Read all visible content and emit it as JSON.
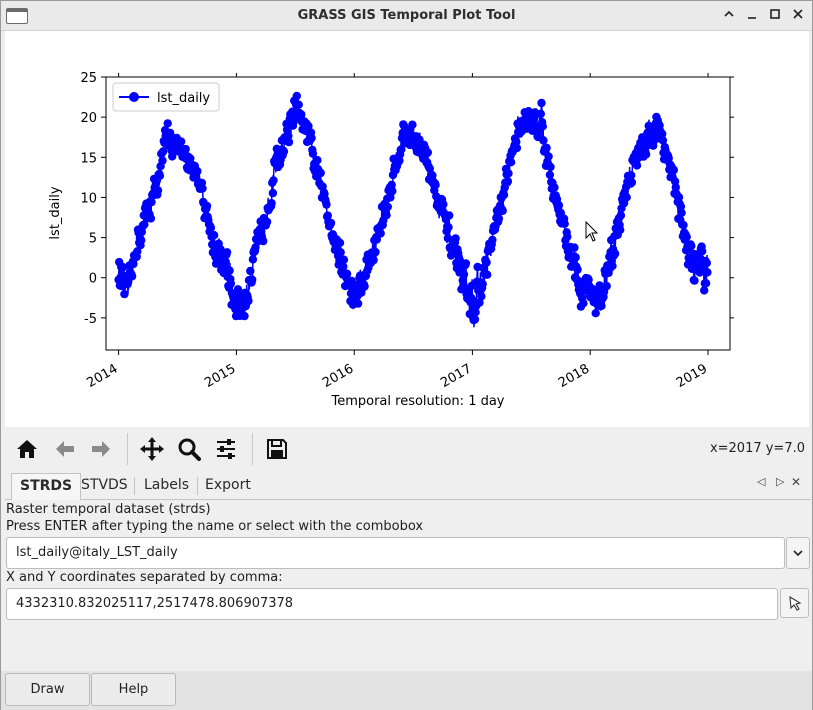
{
  "window": {
    "title": "GRASS GIS Temporal Plot Tool",
    "controls": [
      "minimize-chevron",
      "minimize",
      "maximize",
      "close"
    ]
  },
  "colors": {
    "series": "#0000ff",
    "plot_background": "#ffffff",
    "window_background": "#efefef"
  },
  "chart_data": {
    "type": "line",
    "title": "",
    "xlabel": "Temporal resolution: 1 day",
    "ylabel": "lst_daily",
    "x_ticks": [
      "2014",
      "2015",
      "2016",
      "2017",
      "2018",
      "2019"
    ],
    "y_ticks": [
      "-5",
      "0",
      "5",
      "10",
      "15",
      "20",
      "25"
    ],
    "xlim": [
      "2013-11-23",
      "2019-03-10"
    ],
    "ylim": [
      -9,
      25
    ],
    "grid": false,
    "legend": {
      "position": "top-left",
      "entries": [
        "lst_daily"
      ]
    },
    "marker": "circle",
    "series": [
      {
        "name": "lst_daily",
        "color": "#0000ff",
        "envelope": [
          {
            "date": "2014-01-01",
            "low": -2.0,
            "high": 3.5
          },
          {
            "date": "2014-02-01",
            "low": -5.0,
            "high": 2.0
          },
          {
            "date": "2014-03-01",
            "low": 2.0,
            "high": 8.0
          },
          {
            "date": "2014-04-01",
            "low": 5.0,
            "high": 12.0
          },
          {
            "date": "2014-05-01",
            "low": 9.0,
            "high": 15.0
          },
          {
            "date": "2014-06-01",
            "low": 15.0,
            "high": 21.0
          },
          {
            "date": "2014-07-01",
            "low": 13.0,
            "high": 19.0
          },
          {
            "date": "2014-08-01",
            "low": 12.0,
            "high": 17.0
          },
          {
            "date": "2014-09-01",
            "low": 11.0,
            "high": 15.0
          },
          {
            "date": "2014-10-01",
            "low": 5.0,
            "high": 11.0
          },
          {
            "date": "2014-11-01",
            "low": 0.0,
            "high": 6.0
          },
          {
            "date": "2014-12-01",
            "low": -4.0,
            "high": 5.0
          },
          {
            "date": "2015-01-01",
            "low": -7.0,
            "high": 0.0
          },
          {
            "date": "2015-02-01",
            "low": -6.0,
            "high": 2.0
          },
          {
            "date": "2015-03-01",
            "low": 0.0,
            "high": 6.0
          },
          {
            "date": "2015-04-01",
            "low": 5.0,
            "high": 11.0
          },
          {
            "date": "2015-05-01",
            "low": 10.0,
            "high": 17.0
          },
          {
            "date": "2015-06-01",
            "low": 15.0,
            "high": 20.0
          },
          {
            "date": "2015-07-01",
            "low": 18.0,
            "high": 24.0
          },
          {
            "date": "2015-08-01",
            "low": 16.0,
            "high": 21.0
          },
          {
            "date": "2015-09-01",
            "low": 11.0,
            "high": 17.0
          },
          {
            "date": "2015-10-01",
            "low": 7.0,
            "high": 12.0
          },
          {
            "date": "2015-11-01",
            "low": 2.0,
            "high": 8.0
          },
          {
            "date": "2015-12-01",
            "low": -3.0,
            "high": 4.0
          },
          {
            "date": "2016-01-01",
            "low": -6.0,
            "high": 1.0
          },
          {
            "date": "2016-02-01",
            "low": -3.0,
            "high": 3.0
          },
          {
            "date": "2016-03-01",
            "low": 0.0,
            "high": 7.0
          },
          {
            "date": "2016-04-01",
            "low": 5.0,
            "high": 11.0
          },
          {
            "date": "2016-05-01",
            "low": 10.0,
            "high": 16.0
          },
          {
            "date": "2016-06-01",
            "low": 15.0,
            "high": 21.0
          },
          {
            "date": "2016-07-01",
            "low": 15.0,
            "high": 20.0
          },
          {
            "date": "2016-08-01",
            "low": 13.0,
            "high": 19.0
          },
          {
            "date": "2016-09-01",
            "low": 9.0,
            "high": 15.0
          },
          {
            "date": "2016-10-01",
            "low": 4.0,
            "high": 11.0
          },
          {
            "date": "2016-11-01",
            "low": 0.0,
            "high": 7.0
          },
          {
            "date": "2016-12-01",
            "low": -3.0,
            "high": 3.0
          },
          {
            "date": "2017-01-01",
            "low": -8.0,
            "high": 1.0
          },
          {
            "date": "2017-02-01",
            "low": -5.0,
            "high": 4.0
          },
          {
            "date": "2017-03-01",
            "low": 2.0,
            "high": 7.0
          },
          {
            "date": "2017-04-01",
            "low": 6.0,
            "high": 12.0
          },
          {
            "date": "2017-05-01",
            "low": 12.0,
            "high": 18.0
          },
          {
            "date": "2017-06-01",
            "low": 17.0,
            "high": 23.0
          },
          {
            "date": "2017-07-01",
            "low": 16.0,
            "high": 22.0
          },
          {
            "date": "2017-08-01",
            "low": 16.0,
            "high": 23.0
          },
          {
            "date": "2017-09-01",
            "low": 10.0,
            "high": 15.0
          },
          {
            "date": "2017-10-01",
            "low": 5.0,
            "high": 10.0
          },
          {
            "date": "2017-11-01",
            "low": 0.0,
            "high": 6.0
          },
          {
            "date": "2017-12-01",
            "low": -6.0,
            "high": 3.0
          },
          {
            "date": "2018-01-01",
            "low": -5.0,
            "high": 1.0
          },
          {
            "date": "2018-02-01",
            "low": -6.0,
            "high": 0.0
          },
          {
            "date": "2018-03-01",
            "low": -2.0,
            "high": 5.0
          },
          {
            "date": "2018-04-01",
            "low": 4.0,
            "high": 11.0
          },
          {
            "date": "2018-05-01",
            "low": 10.0,
            "high": 16.0
          },
          {
            "date": "2018-06-01",
            "low": 13.0,
            "high": 18.0
          },
          {
            "date": "2018-07-01",
            "low": 15.0,
            "high": 21.0
          },
          {
            "date": "2018-08-01",
            "low": 16.0,
            "high": 22.0
          },
          {
            "date": "2018-09-01",
            "low": 11.0,
            "high": 17.0
          },
          {
            "date": "2018-10-01",
            "low": 6.0,
            "high": 12.0
          },
          {
            "date": "2018-11-01",
            "low": -1.0,
            "high": 6.0
          },
          {
            "date": "2018-12-01",
            "low": -4.0,
            "high": 5.0
          }
        ]
      }
    ]
  },
  "toolbar": {
    "buttons": [
      {
        "name": "home",
        "icon": "home-icon"
      },
      {
        "name": "back",
        "icon": "arrow-left-icon"
      },
      {
        "name": "forward",
        "icon": "arrow-right-icon"
      },
      {
        "name": "pan",
        "icon": "move-icon"
      },
      {
        "name": "zoom",
        "icon": "magnifier-icon"
      },
      {
        "name": "configure",
        "icon": "sliders-icon"
      },
      {
        "name": "save",
        "icon": "floppy-icon"
      }
    ],
    "coords": "x=2017 y=7.0"
  },
  "tabs": [
    {
      "label": "STRDS",
      "active": true
    },
    {
      "label": "STVDS",
      "active": false
    },
    {
      "label": "Labels",
      "active": false
    },
    {
      "label": "Export",
      "active": false
    }
  ],
  "tab_controls": [
    "◁",
    "▷",
    "✕"
  ],
  "strds": {
    "heading": "Raster temporal dataset (strds)",
    "hint": "Press ENTER after typing the name or select with the combobox",
    "dataset_value": "lst_daily@italy_LST_daily",
    "coords_label": "X and Y coordinates separated by comma:",
    "coords_value": "4332310.832025117,2517478.806907378"
  },
  "buttons": {
    "draw": "Draw",
    "help": "Help"
  }
}
